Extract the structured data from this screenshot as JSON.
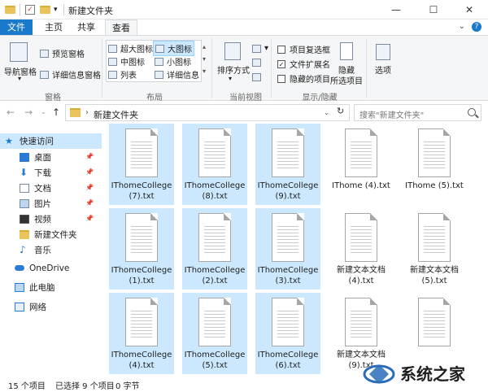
{
  "window": {
    "title": "新建文件夹",
    "controls": {
      "minimize": "—",
      "maximize": "☐",
      "close": "✕"
    }
  },
  "tabs": [
    {
      "label": "文件"
    },
    {
      "label": "主页"
    },
    {
      "label": "共享"
    },
    {
      "label": "查看"
    }
  ],
  "ribbon": {
    "panes": {
      "nav_pane": "导航窗格",
      "preview_pane": "预览窗格",
      "details_pane": "详细信息窗格",
      "group_label": "窗格"
    },
    "layout": {
      "items": [
        "超大图标",
        "大图标",
        "中图标",
        "小图标",
        "列表",
        "详细信息"
      ],
      "selected": "大图标",
      "group_label": "布局"
    },
    "current_view": {
      "sort_by": "排序方式",
      "group_label": "当前视图"
    },
    "show_hide": {
      "item_checkboxes": "项目复选框",
      "file_extensions": "文件扩展名",
      "hidden_items": "隐藏的项目",
      "hide_selected": "隐藏",
      "hide_selected_2": "所选项目",
      "group_label": "显示/隐藏",
      "file_extensions_checked": true,
      "item_checkboxes_checked": false,
      "hidden_items_checked": false
    },
    "options": "选项"
  },
  "address": {
    "path": "新建文件夹",
    "search_placeholder": "搜索\"新建文件夹\""
  },
  "sidebar": {
    "quick_access": "快速访问",
    "items": [
      {
        "label": "桌面",
        "icon": "desktop-icon"
      },
      {
        "label": "下载",
        "icon": "download-icon"
      },
      {
        "label": "文档",
        "icon": "document-icon"
      },
      {
        "label": "图片",
        "icon": "picture-icon"
      },
      {
        "label": "视频",
        "icon": "video-icon"
      },
      {
        "label": "新建文件夹",
        "icon": "folder-icon"
      },
      {
        "label": "音乐",
        "icon": "music-icon"
      }
    ],
    "onedrive": "OneDrive",
    "this_pc": "此电脑",
    "network": "网络"
  },
  "files": [
    {
      "name": "IThomeCollege (7).txt",
      "selected": true
    },
    {
      "name": "IThomeCollege (8).txt",
      "selected": true
    },
    {
      "name": "IThomeCollege (9).txt",
      "selected": true
    },
    {
      "name": "IThome (4).txt",
      "selected": false
    },
    {
      "name": "IThome (5).txt",
      "selected": false
    },
    {
      "name": "IThomeCollege (1).txt",
      "selected": true
    },
    {
      "name": "IThomeCollege (2).txt",
      "selected": true
    },
    {
      "name": "IThomeCollege (3).txt",
      "selected": true
    },
    {
      "name": "新建文本文档 (4).txt",
      "selected": false
    },
    {
      "name": "新建文本文档 (5).txt",
      "selected": false
    },
    {
      "name": "IThomeCollege (4).txt",
      "selected": true
    },
    {
      "name": "IThomeCollege (5).txt",
      "selected": true
    },
    {
      "name": "IThomeCollege (6).txt",
      "selected": true
    },
    {
      "name": "新建文本文档 (9).txt",
      "selected": false
    },
    {
      "name": "",
      "selected": false
    }
  ],
  "status": {
    "count": "15 个项目",
    "selected": "已选择 9 个项目",
    "size": "0 字节"
  },
  "watermark": {
    "text": "系统之家"
  }
}
